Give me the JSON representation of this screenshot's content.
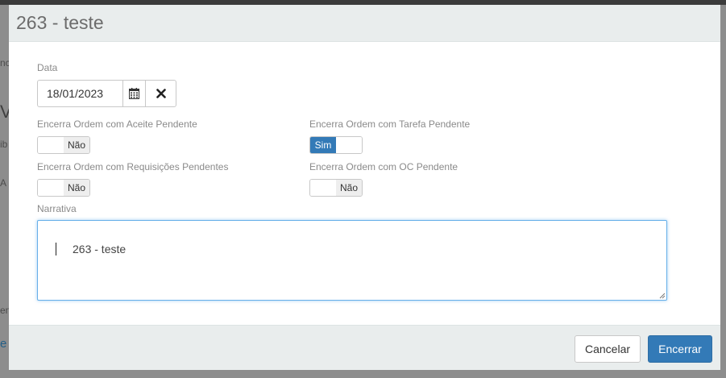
{
  "background": {
    "fragments": [
      "nc",
      "V",
      "ib",
      "A",
      "en",
      "e"
    ]
  },
  "modal": {
    "title": "263 - teste",
    "data": {
      "label": "Data",
      "value": "18/01/2023"
    },
    "toggles": [
      {
        "label": "Encerra Ordem com Aceite Pendente",
        "state": "Não"
      },
      {
        "label": "Encerra Ordem com Tarefa Pendente",
        "state": "Sim"
      },
      {
        "label": "Encerra Ordem com Requisições Pendentes",
        "state": "Não"
      },
      {
        "label": "Encerra Ordem com OC Pendente",
        "state": "Não"
      }
    ],
    "narrativa": {
      "label": "Narrativa",
      "value": "263 - teste"
    },
    "footer": {
      "cancel_label": "Cancelar",
      "submit_label": "Encerrar"
    }
  },
  "colors": {
    "primary": "#337ab7",
    "header_bg": "#e9eded",
    "focus_border": "#66afe9"
  },
  "icons": {
    "calendar": "calendar-icon",
    "clear": "close-icon"
  }
}
